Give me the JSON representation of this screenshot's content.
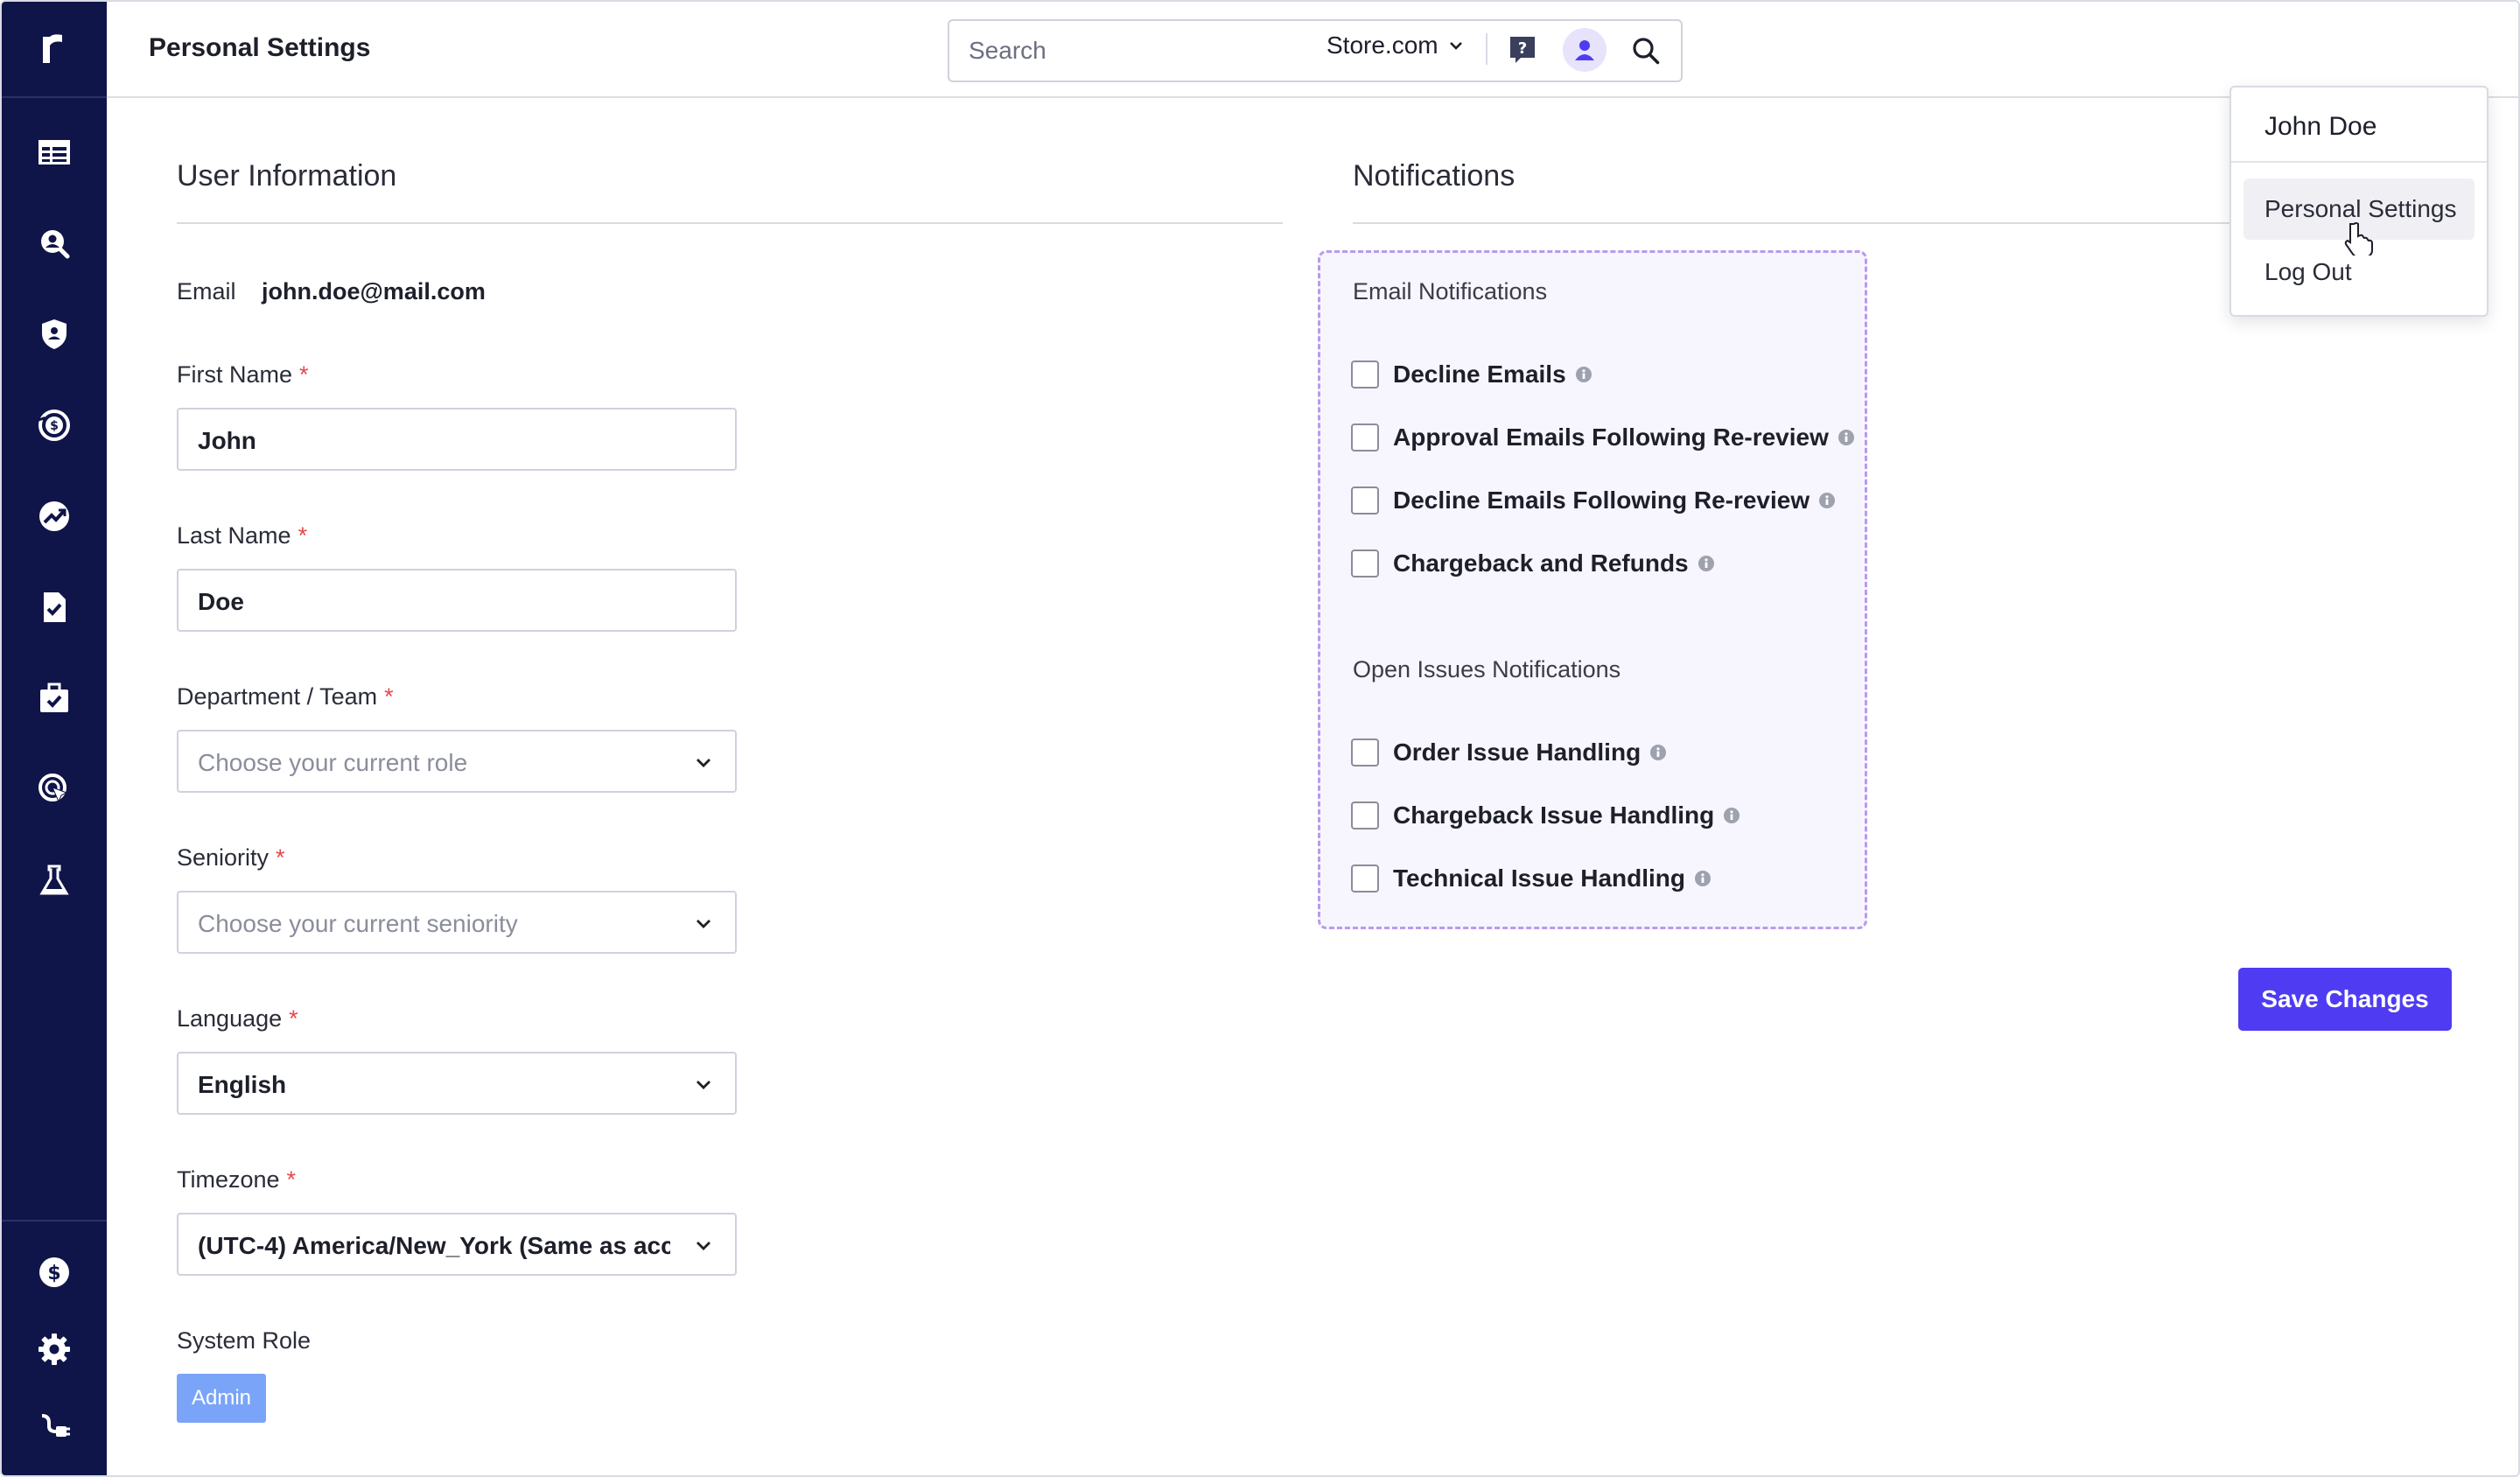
{
  "header": {
    "title": "Personal Settings",
    "search_placeholder": "Search",
    "store": "Store.com"
  },
  "user_info": {
    "section_title": "User Information",
    "email_label": "Email",
    "email_value": "john.doe@mail.com",
    "first_name": {
      "label": "First Name",
      "value": "John"
    },
    "last_name": {
      "label": "Last Name",
      "value": "Doe"
    },
    "department": {
      "label": "Department / Team",
      "placeholder": "Choose your current role"
    },
    "seniority": {
      "label": "Seniority",
      "placeholder": "Choose your current seniority"
    },
    "language": {
      "label": "Language",
      "value": "English"
    },
    "timezone": {
      "label": "Timezone",
      "value": "(UTC-4) America/New_York (Same as acc..."
    },
    "system_role": {
      "label": "System Role",
      "value": "Admin"
    },
    "required_mark": "*"
  },
  "notifications": {
    "section_title": "Notifications",
    "email_group": {
      "title": "Email Notifications",
      "items": [
        {
          "label": "Decline Emails",
          "checked": false
        },
        {
          "label": "Approval Emails Following Re-review",
          "checked": false
        },
        {
          "label": "Decline Emails Following Re-review",
          "checked": false
        },
        {
          "label": "Chargeback and Refunds",
          "checked": false
        }
      ]
    },
    "issues_group": {
      "title": "Open Issues Notifications",
      "items": [
        {
          "label": "Order Issue Handling",
          "checked": false
        },
        {
          "label": "Chargeback Issue Handling",
          "checked": false
        },
        {
          "label": "Technical Issue Handling",
          "checked": false
        }
      ]
    }
  },
  "save_button": "Save Changes",
  "user_menu": {
    "name": "John Doe",
    "items": [
      "Personal Settings",
      "Log Out"
    ]
  },
  "colors": {
    "sidebar": "#0f1549",
    "accent": "#4f3cf2",
    "notif_bg": "#f7f5fd",
    "notif_border": "#b99af0",
    "role_badge": "#7aa4f7"
  },
  "sidebar_icons": [
    "logo-icon",
    "table-icon",
    "search-user-icon",
    "shield-icon",
    "refund-icon",
    "trend-icon",
    "document-check-icon",
    "briefcase-icon",
    "target-icon",
    "flask-icon",
    "dollar-icon",
    "gear-icon",
    "plug-icon"
  ]
}
